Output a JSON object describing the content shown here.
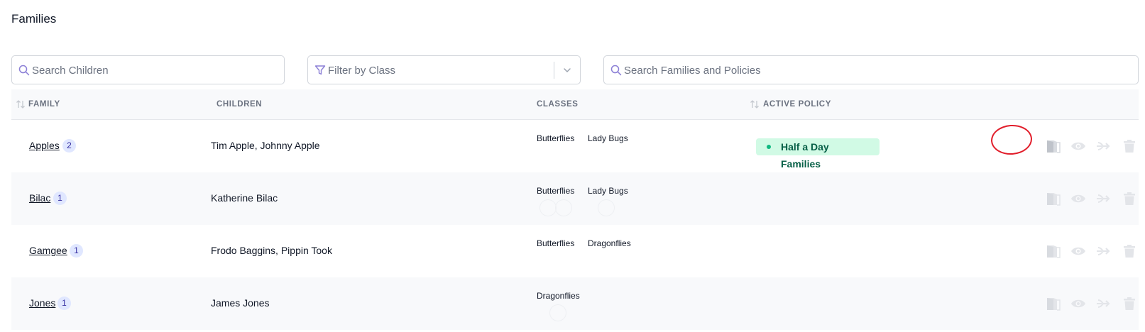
{
  "page": {
    "title": "Families"
  },
  "filters": {
    "search_children_placeholder": "Search Children",
    "filter_class_placeholder": "Filter by Class",
    "search_families_placeholder": "Search Families and Policies"
  },
  "table": {
    "headers": {
      "family": "FAMILY",
      "children": "CHILDREN",
      "classes": "CLASSES",
      "active_policy": "ACTIVE POLICY"
    },
    "rows": [
      {
        "family": "Apples",
        "count": "2",
        "children": "Tim Apple, Johnny Apple",
        "classes": [
          "Butterflies",
          "Lady Bugs"
        ],
        "policy": "Half a Day Families"
      },
      {
        "family": "Bilac",
        "count": "1",
        "children": "Katherine Bilac",
        "classes": [
          "Butterflies",
          "Lady Bugs"
        ],
        "policy": ""
      },
      {
        "family": "Gamgee",
        "count": "1",
        "children": "Frodo Baggins, Pippin Took",
        "classes": [
          "Butterflies",
          "Dragonflies"
        ],
        "policy": ""
      },
      {
        "family": "Jones",
        "count": "1",
        "children": "James Jones",
        "classes": [
          "Dragonflies"
        ],
        "policy": ""
      }
    ]
  },
  "icons": {
    "row_actions": [
      "door-exit-icon",
      "eye-icon",
      "arrow-right-icon",
      "trash-icon"
    ]
  },
  "colors": {
    "accent": "#4f46e5",
    "policy_bg": "#d1fae5",
    "policy_text": "#065f46",
    "annotation": "#e11d2a"
  }
}
